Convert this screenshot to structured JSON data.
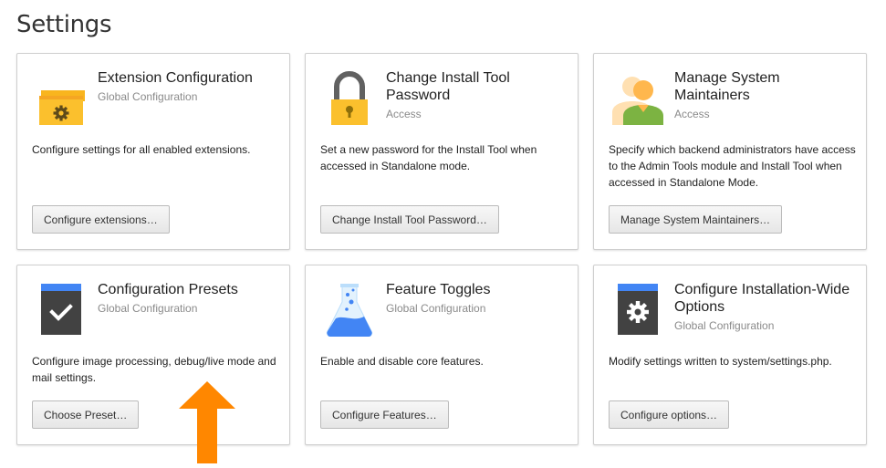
{
  "page": {
    "title": "Settings"
  },
  "colors": {
    "card_border": "#cfcfcf",
    "button_bg": "#ececec",
    "icon_yellow": "#fbc02d",
    "icon_dark": "#424242",
    "icon_blue": "#4285f4",
    "arrow_orange": "#ff8700"
  },
  "cards": [
    {
      "icon": "extension-box-icon",
      "title": "Extension Configuration",
      "category": "Global Configuration",
      "description": "Configure settings for all enabled extensions.",
      "button": "Configure extensions…"
    },
    {
      "icon": "lock-icon",
      "title": "Change Install Tool Password",
      "category": "Access",
      "description": "Set a new password for the Install Tool when accessed in Standalone mode.",
      "button": "Change Install Tool Password…"
    },
    {
      "icon": "users-icon",
      "title": "Manage System Maintainers",
      "category": "Access",
      "description": "Specify which backend administrators have access to the Admin Tools module and Install Tool when accessed in Standalone Mode.",
      "button": "Manage System Maintainers…"
    },
    {
      "icon": "checkbox-preset-icon",
      "title": "Configuration Presets",
      "category": "Global Configuration",
      "description": "Configure image processing, debug/live mode and mail settings.",
      "button": "Choose Preset…"
    },
    {
      "icon": "flask-icon",
      "title": "Feature Toggles",
      "category": "Global Configuration",
      "description": "Enable and disable core features.",
      "button": "Configure Features…"
    },
    {
      "icon": "gear-icon",
      "title": "Configure Installation-Wide Options",
      "category": "Global Configuration",
      "description": "Modify settings written to system/settings.php.",
      "button": "Configure options…"
    }
  ],
  "annotation": {
    "icon": "arrow-up-icon"
  }
}
